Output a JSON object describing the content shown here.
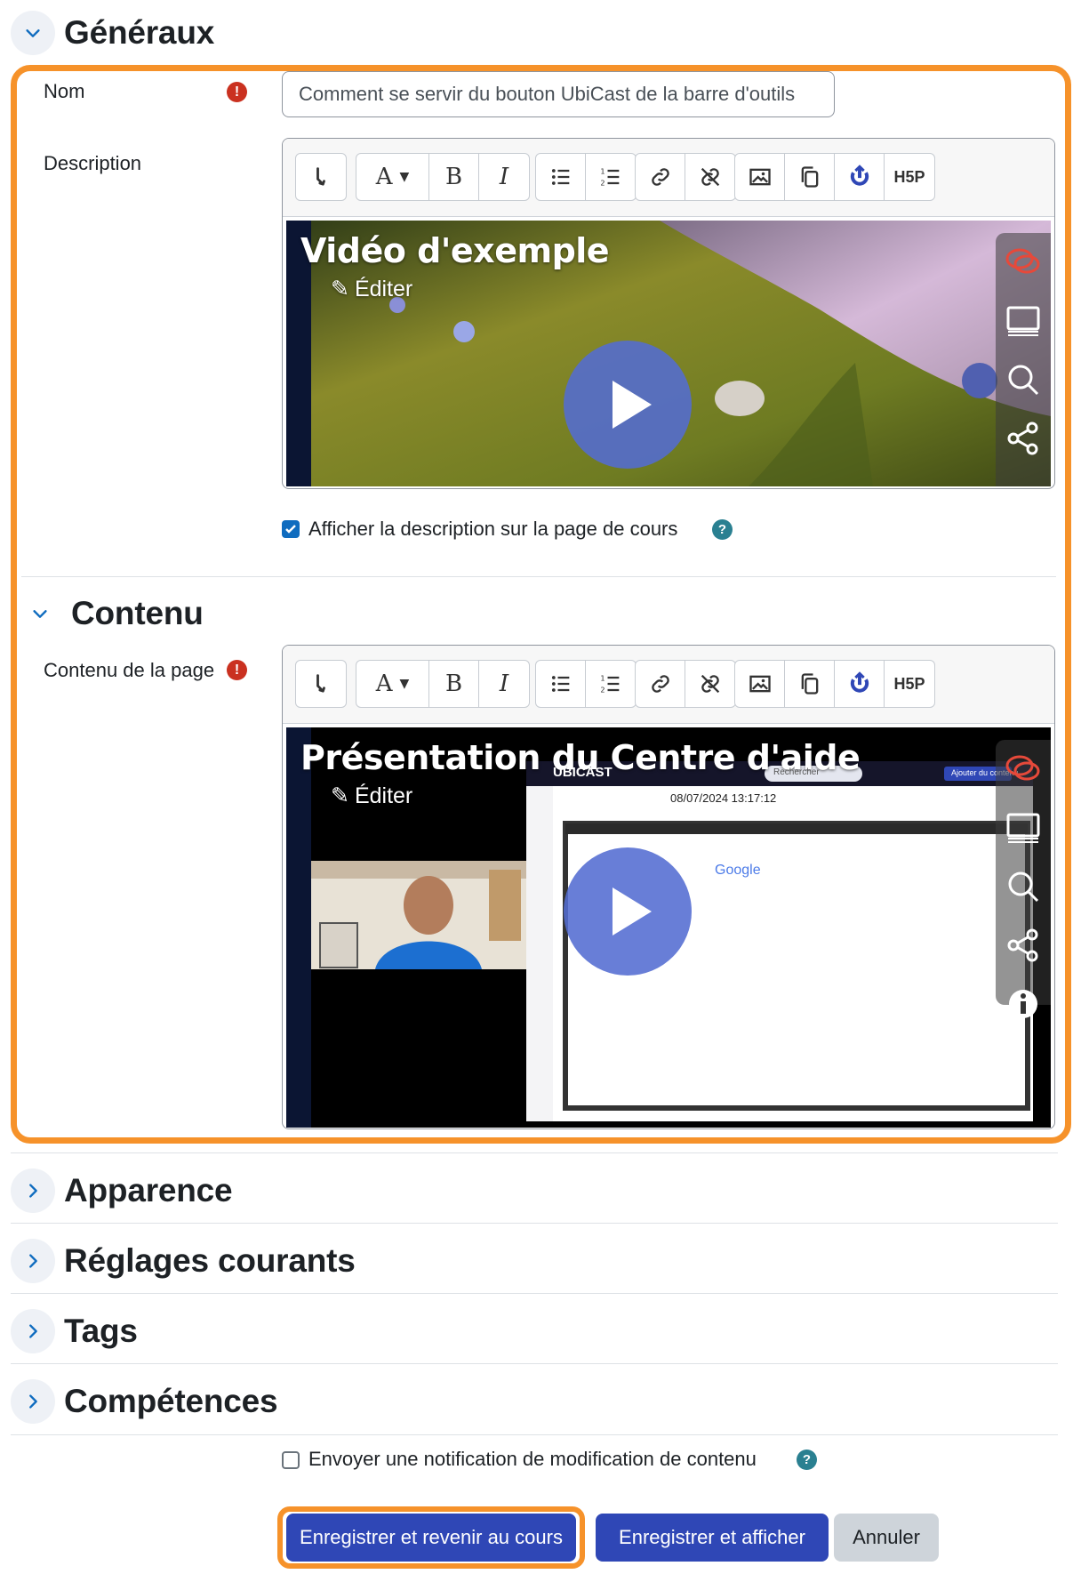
{
  "sections": {
    "general": {
      "title": "Généraux"
    },
    "content": {
      "title": "Contenu"
    },
    "appearance": {
      "title": "Apparence"
    },
    "common_settings": {
      "title": "Réglages courants"
    },
    "tags": {
      "title": "Tags"
    },
    "competencies": {
      "title": "Compétences"
    }
  },
  "name_field": {
    "label": "Nom",
    "value": "Comment se servir du bouton UbiCast de la barre d'outils"
  },
  "description_field": {
    "label": "Description"
  },
  "page_content_field": {
    "label": "Contenu de la page"
  },
  "toolbar": {
    "buttons": [
      "collapse-icon",
      "font-color-icon",
      "bold-icon",
      "italic-icon",
      "unordered-list-icon",
      "ordered-list-icon",
      "link-icon",
      "unlink-icon",
      "image-icon",
      "copy-icon",
      "ubicast-icon",
      "h5p-icon"
    ],
    "font_label": "A",
    "bold_label": "B",
    "italic_label": "I",
    "h5p_label": "H5P"
  },
  "description_video": {
    "title": "Vidéo d'exemple",
    "edit_label": "Éditer"
  },
  "content_video": {
    "title": "Présentation du Centre d'aide",
    "edit_label": "Éditer",
    "timestamp": "08/07/2024 13:17:12",
    "brand_label": "UBICAST",
    "search_placeholder": "Rechercher",
    "add_content_label": "Ajouter du contenu",
    "google_label": "Google"
  },
  "show_description": {
    "label": "Afficher la description sur la page de cours",
    "checked": true
  },
  "notify": {
    "label": "Envoyer une notification de modification de contenu",
    "checked": false
  },
  "actions": {
    "save_return": "Enregistrer et revenir au cours",
    "save_display": "Enregistrer et afficher",
    "cancel": "Annuler"
  },
  "colors": {
    "highlight": "#f6922a",
    "primary": "#2f47b6",
    "error": "#ca3120",
    "help": "#2a8091",
    "play": "#536cd2"
  }
}
